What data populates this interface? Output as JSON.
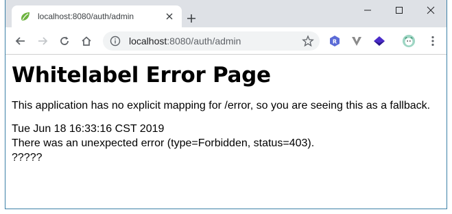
{
  "browser": {
    "tab_title": "localhost:8080/auth/admin",
    "url_host": "localhost",
    "url_rest": ":8080/auth/admin",
    "favicon": "spring-leaf-icon",
    "accent_colors": {
      "favicon_green": "#6db33f",
      "window_border": "#3b7fa6",
      "ext_r": "#5b6bd6",
      "ext_v": "#8a8a8a",
      "ext_stack": "#4b2cc9"
    }
  },
  "page": {
    "heading": "Whitelabel Error Page",
    "description": "This application has no explicit mapping for /error, so you are seeing this as a fallback.",
    "timestamp": "Tue Jun 18 16:33:16 CST 2019",
    "error_line": "There was an unexpected error (type=Forbidden, status=403).",
    "message": "?????"
  }
}
